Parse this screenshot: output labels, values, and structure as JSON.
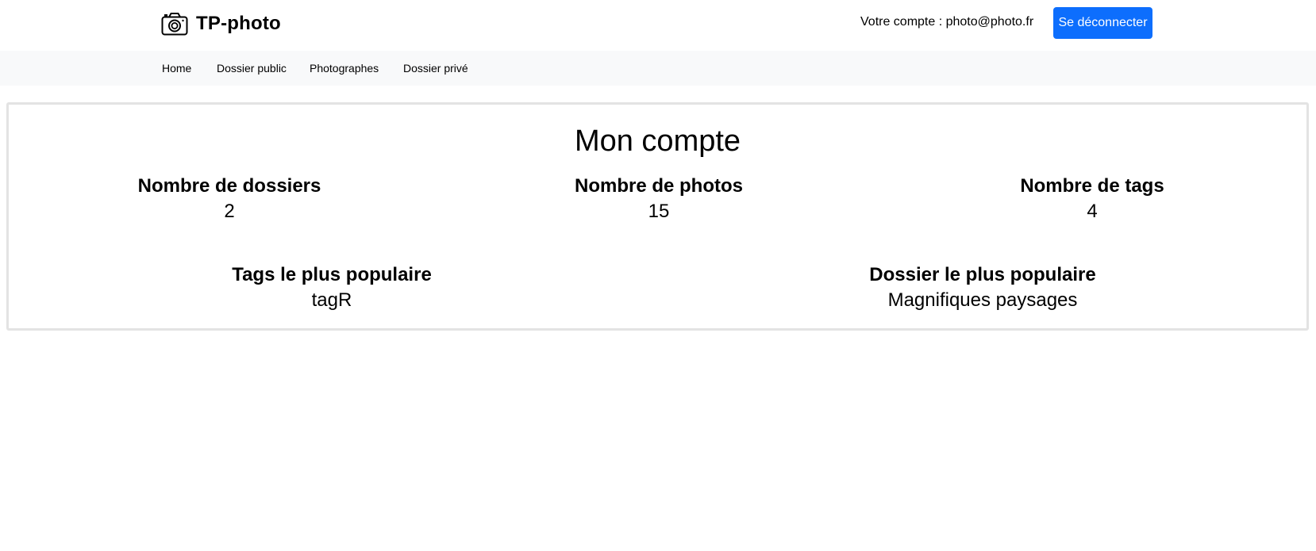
{
  "header": {
    "brand_icon": "camera-icon",
    "brand_title": "TP-photo",
    "account_text": "Votre compte : photo@photo.fr",
    "logout_label": "Se déconnecter",
    "accent_color": "#0d6efd"
  },
  "nav": {
    "items": [
      {
        "label": "Home"
      },
      {
        "label": "Dossier public"
      },
      {
        "label": "Photographes"
      },
      {
        "label": "Dossier privé"
      }
    ]
  },
  "main": {
    "title": "Mon compte",
    "stats": [
      {
        "label": "Nombre de dossiers",
        "value": "2"
      },
      {
        "label": "Nombre de photos",
        "value": "15"
      },
      {
        "label": "Nombre de tags",
        "value": "4"
      }
    ],
    "popular": [
      {
        "label": "Tags le plus populaire",
        "value": "tagR"
      },
      {
        "label": "Dossier le plus populaire",
        "value": "Magnifiques paysages"
      }
    ]
  }
}
